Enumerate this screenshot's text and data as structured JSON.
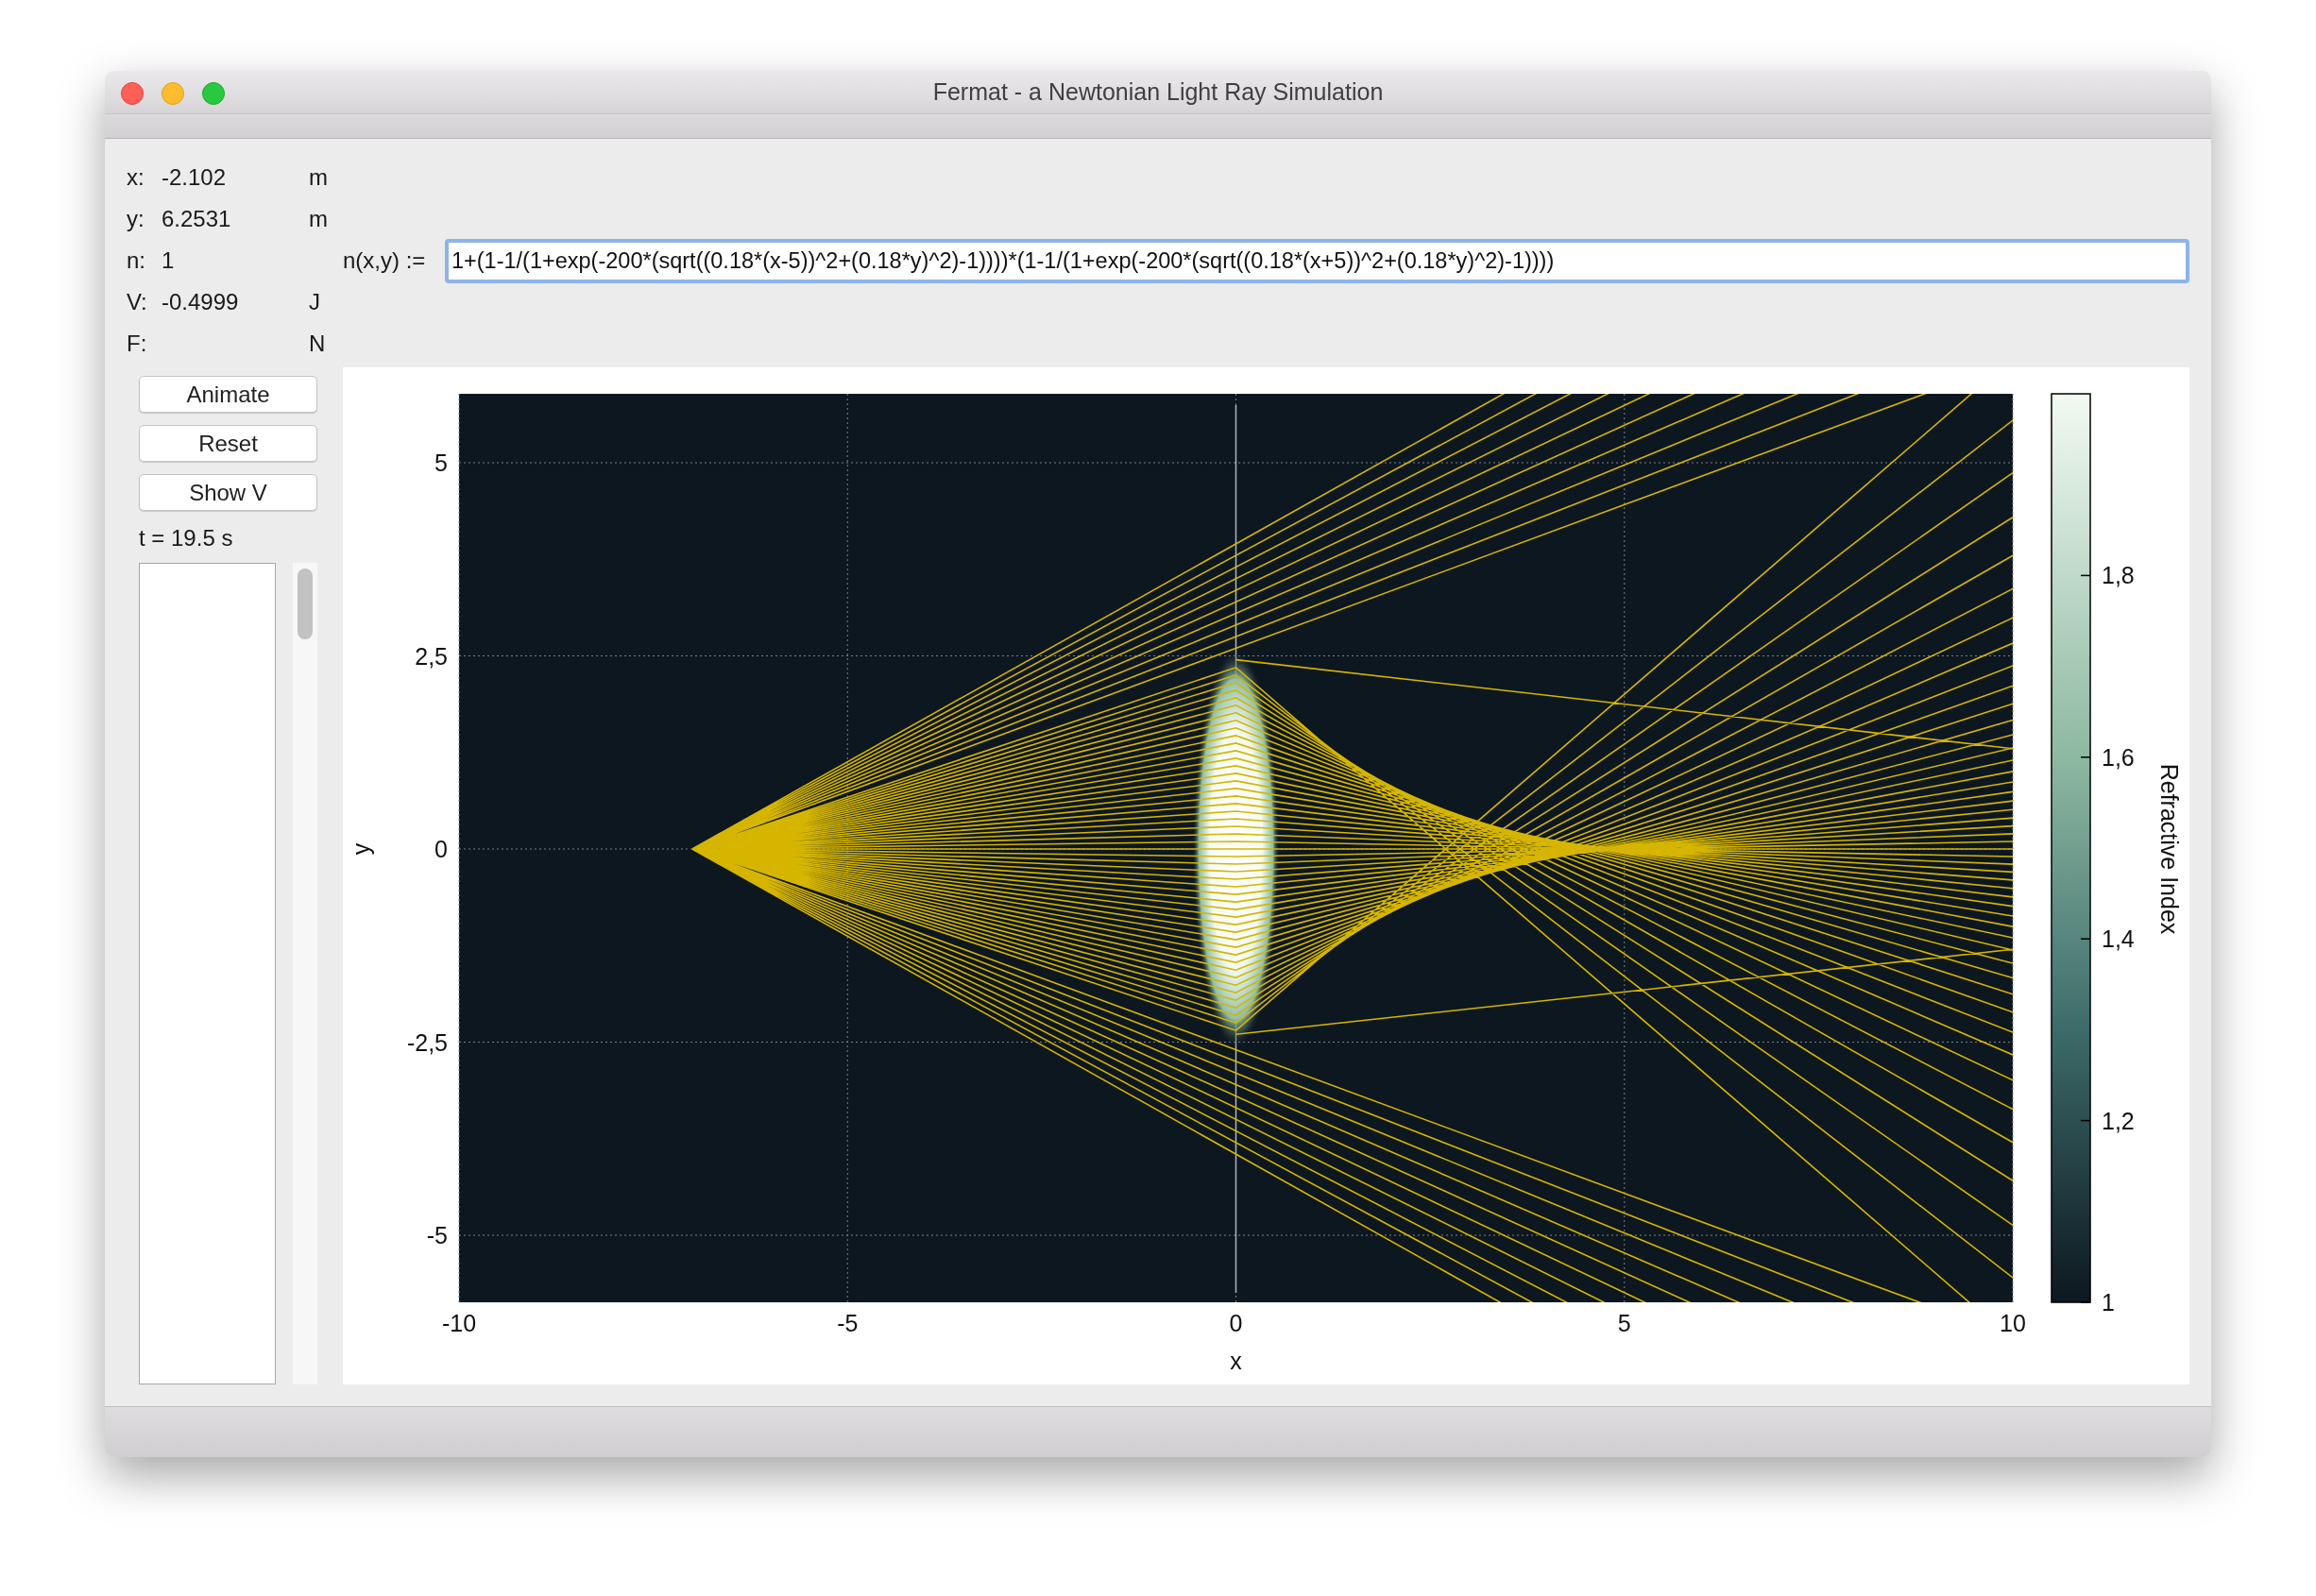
{
  "window": {
    "title": "Fermat - a Newtonian Light Ray Simulation"
  },
  "readouts": [
    {
      "label": "x:",
      "value": "-2.102",
      "unit": "m"
    },
    {
      "label": "y:",
      "value": "6.2531",
      "unit": "m"
    },
    {
      "label": "n:",
      "value": "1"
    },
    {
      "label": "V:",
      "value": "-0.4999",
      "unit": "J"
    },
    {
      "label": "F:",
      "unit": "N"
    }
  ],
  "formula": {
    "label": "n(x,y) :=",
    "value": "1+(1-1/(1+exp(-200*(sqrt((0.18*(x-5))^2+(0.18*y)^2)-1))))*(1-1/(1+exp(-200*(sqrt((0.18*(x+5))^2+(0.18*y)^2)-1))))"
  },
  "buttons": [
    "Animate",
    "Reset",
    "Show V"
  ],
  "time": "t = 19.5 s",
  "plot": {
    "xlabel": "x",
    "ylabel": "y",
    "xticks": [
      "-10",
      "-5",
      "0",
      "5",
      "10"
    ],
    "yticks": [
      "5",
      "2,5",
      "0",
      "-2,5",
      "-5"
    ],
    "colorbar": {
      "label": "Refractive Index",
      "ticks": [
        "1,8",
        "1,6",
        "1,4",
        "1,2",
        "1"
      ]
    }
  }
}
